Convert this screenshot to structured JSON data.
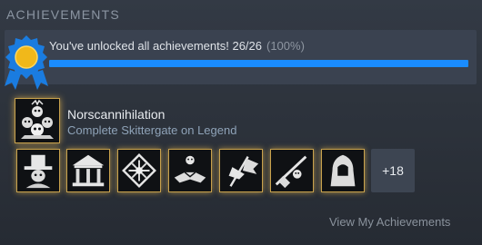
{
  "section": {
    "title": "ACHIEVEMENTS"
  },
  "banner": {
    "unlock_text": "You've unlocked all achievements! 26/26",
    "percent_text": "(100%)",
    "progress_fraction": 1.0,
    "progress_color": "#1a8cff"
  },
  "featured": {
    "name": "Norscannihilation",
    "description": "Complete Skittergate on Legend",
    "icon": "skull-pile-icon"
  },
  "achievements": [
    {
      "icon": "witch-hunter-icon"
    },
    {
      "icon": "shrine-icon"
    },
    {
      "icon": "snowflake-crest-icon"
    },
    {
      "icon": "handshake-icon"
    },
    {
      "icon": "torn-banner-icon"
    },
    {
      "icon": "musket-icon"
    },
    {
      "icon": "hooded-figure-icon"
    }
  ],
  "more_count": "+18",
  "footer": {
    "link_text": "View My Achievements"
  },
  "colors": {
    "accent_gold": "#c8a24d",
    "ribbon_blue": "#1a7ce0",
    "ribbon_gold": "#f1b81a"
  }
}
